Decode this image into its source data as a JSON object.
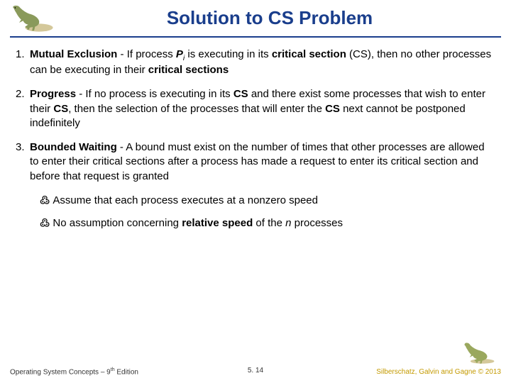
{
  "header": {
    "title": "Solution to CS Problem"
  },
  "items": [
    {
      "num": "1.",
      "term": "Mutual Exclusion",
      "pre": " - If process ",
      "proc": "P",
      "sub": "i",
      "mid": " is executing in its ",
      "cs": "critical section",
      "csabbr": " (CS)",
      "post1": ", then no other processes can be executing in their ",
      "cs2": "critical sections"
    },
    {
      "num": "2.",
      "term": "Progress",
      "text1": " - If no process is executing in its ",
      "b1": "CS",
      "text2": " and there exist some processes that wish to enter their ",
      "b2": "CS",
      "text3": ", then the selection of the processes that will enter the ",
      "b3": "CS",
      "text4": " next cannot be postponed indefinitely"
    },
    {
      "num": "3.",
      "term": "Bounded Waiting",
      "text1": " -  A bound must exist on the number of times that other processes are allowed to enter their critical sections after a process has made a request to enter its critical section and before that request is granted"
    }
  ],
  "subs": [
    {
      "text": "Assume that each process executes at a nonzero speed"
    },
    {
      "pre": "No assumption concerning ",
      "b1": "relative speed",
      "mid": " of the ",
      "i1": "n",
      "post": " processes"
    }
  ],
  "footer": {
    "left_pre": "Operating System Concepts – 9",
    "left_sup": "th",
    "left_post": " Edition",
    "center": "5. 14",
    "right": "Silberschatz, Galvin and Gagne © 2013"
  }
}
